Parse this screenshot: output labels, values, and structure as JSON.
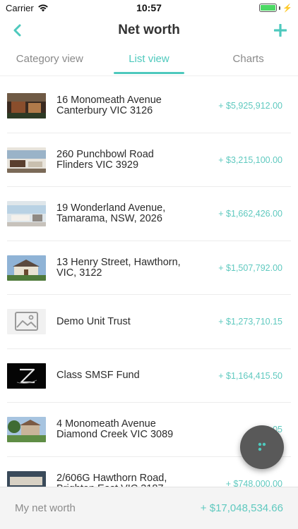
{
  "status_bar": {
    "carrier": "Carrier",
    "time": "10:57"
  },
  "header": {
    "title": "Net worth",
    "back_icon": "chevron-left-icon",
    "add_icon": "plus-icon"
  },
  "tabs": [
    {
      "label": "Category view",
      "active": false
    },
    {
      "label": "List view",
      "active": true
    },
    {
      "label": "Charts",
      "active": false
    }
  ],
  "assets": [
    {
      "name": "16 Monomeath Avenue\nCanterbury VIC 3126",
      "value": "+ $5,925,912.00",
      "thumb": "house-photo"
    },
    {
      "name": "260 Punchbowl Road\nFlinders VIC 3929",
      "value": "+ $3,215,100.00",
      "thumb": "interior-photo"
    },
    {
      "name": "19 Wonderland Avenue,\nTamarama, NSW, 2026",
      "value": "+ $1,662,426.00",
      "thumb": "living-room-photo"
    },
    {
      "name": "13 Henry Street, Hawthorn,\nVIC, 3122",
      "value": "+ $1,507,792.00",
      "thumb": "house-facade-photo"
    },
    {
      "name": "Demo Unit Trust",
      "value": "+ $1,273,710.15",
      "thumb": "image-placeholder-icon"
    },
    {
      "name": "Class SMSF Fund",
      "value": "+ $1,164,415.50",
      "thumb": "fund-logo"
    },
    {
      "name": "4 Monomeath Avenue\nDiamond Creek VIC 3089",
      "value": "+ $1,05",
      "thumb": "garden-house-photo"
    },
    {
      "name": "2/606G Hawthorn Road,\nBrighton East VIC 3187",
      "value": "+ $748,000.00",
      "thumb": "pool-house-photo"
    }
  ],
  "footer": {
    "label": "My net worth",
    "value": "+ $17,048,534.66"
  },
  "colors": {
    "accent": "#4ec9bd",
    "value_text": "#5fc9bf",
    "fab": "#595959"
  }
}
